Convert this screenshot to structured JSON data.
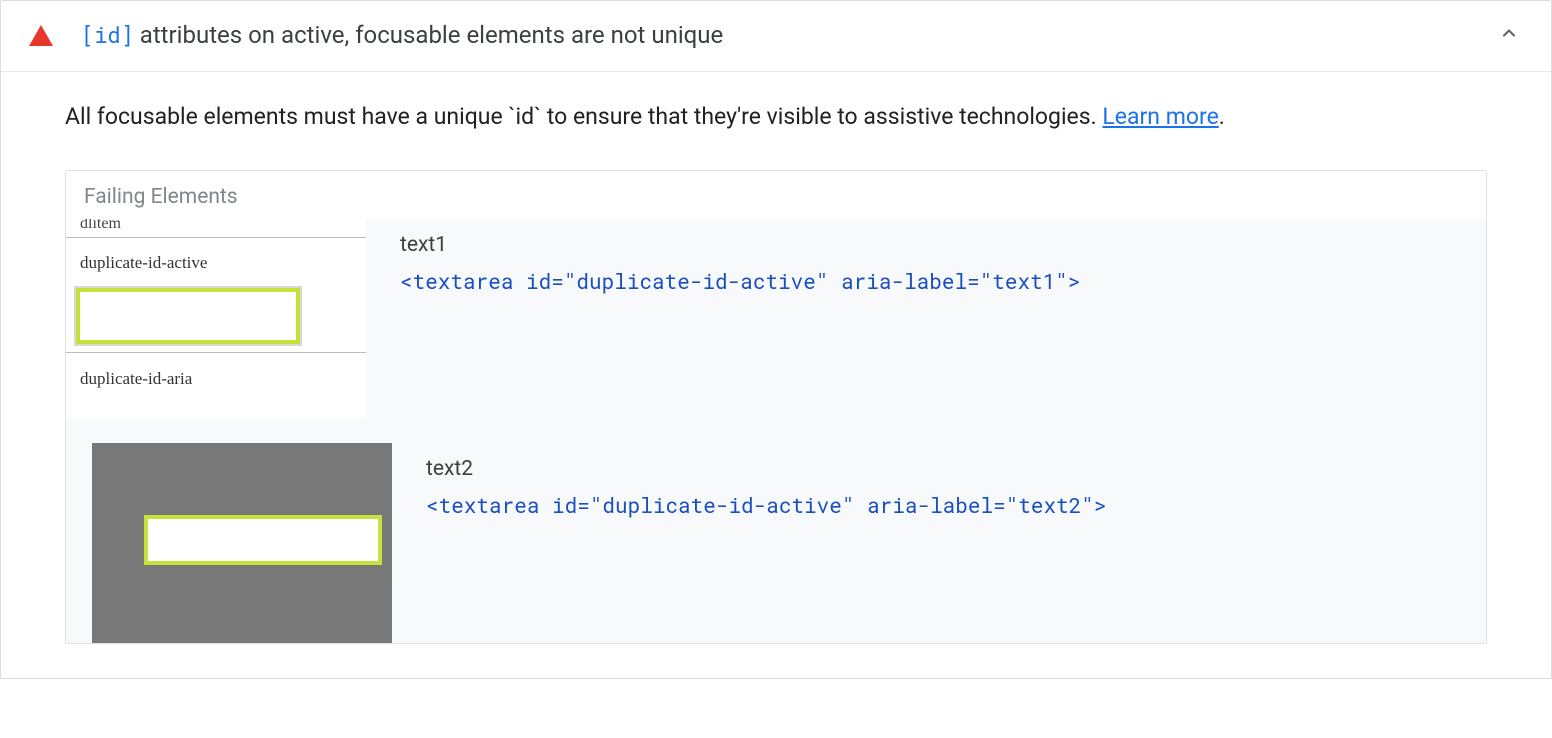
{
  "audit": {
    "code_attr": "[id]",
    "title_rest": " attributes on active, focusable elements are not unique",
    "description_text": "All focusable elements must have a unique `id` to ensure that they're visible to assistive technologies. ",
    "learn_more": "Learn more",
    "description_period": "."
  },
  "failing": {
    "header": "Failing Elements",
    "items": [
      {
        "label": "text1",
        "code": "<textarea id=\"duplicate-id-active\" aria-label=\"text1\">",
        "thumb_labels": {
          "partial_top": "dlitem",
          "mid": "duplicate-id-active",
          "bottom": "duplicate-id-aria"
        }
      },
      {
        "label": "text2",
        "code": "<textarea id=\"duplicate-id-active\" aria-label=\"text2\">"
      }
    ]
  }
}
